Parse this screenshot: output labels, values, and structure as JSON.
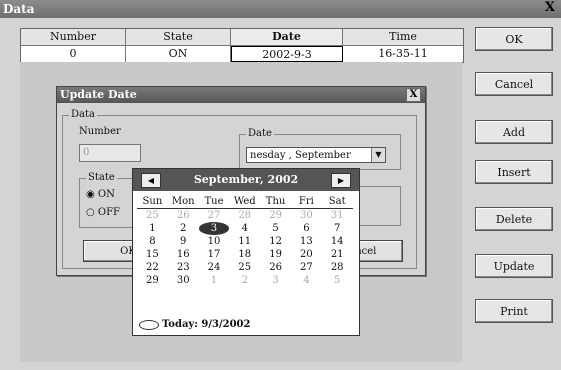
{
  "window": {
    "title": "Data",
    "close": "X"
  },
  "grid": {
    "headers": [
      "Number",
      "State",
      "Date",
      "Time"
    ],
    "row": [
      "0",
      "ON",
      "2002-9-3",
      "16-35-11"
    ]
  },
  "buttons": {
    "ok": "OK",
    "cancel": "Cancel",
    "add": "Add",
    "insert": "Insert",
    "delete": "Delete",
    "update": "Update",
    "print": "Print"
  },
  "dialog": {
    "title": "Update Date",
    "close": "X",
    "group_data": "Data",
    "number_label": "Number",
    "number_value": "0",
    "date_group": "Date",
    "date_value": "nesday , September",
    "state_group": "State",
    "radio_on": "ON",
    "radio_off": "OFF",
    "ok_label": "OK",
    "cancel_label": "Cancel"
  },
  "calendar": {
    "month": "September, 2002",
    "prev": "◀",
    "next": "▶",
    "dow": [
      "Sun",
      "Mon",
      "Tue",
      "Wed",
      "Thu",
      "Fri",
      "Sat"
    ],
    "weeks": [
      [
        "25",
        "26",
        "27",
        "28",
        "29",
        "30",
        "31"
      ],
      [
        "1",
        "2",
        "3",
        "4",
        "5",
        "6",
        "7"
      ],
      [
        "8",
        "9",
        "10",
        "11",
        "12",
        "13",
        "14"
      ],
      [
        "15",
        "16",
        "17",
        "18",
        "19",
        "20",
        "21"
      ],
      [
        "22",
        "23",
        "24",
        "25",
        "26",
        "27",
        "28"
      ],
      [
        "29",
        "30",
        "1",
        "2",
        "3",
        "4",
        "5"
      ]
    ],
    "selected": "3",
    "today_label": "Today: 9/3/2002"
  }
}
